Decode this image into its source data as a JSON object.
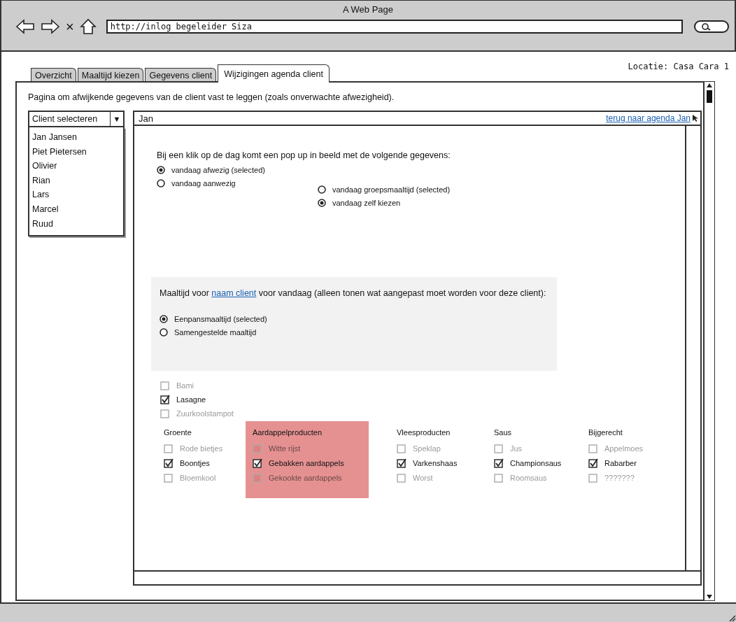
{
  "browser": {
    "title": "A Web Page",
    "url": "http://inlog begeleider Siza",
    "close_glyph": "×"
  },
  "tabs": [
    {
      "label": "Overzicht",
      "selected": false
    },
    {
      "label": "Maaltijd kiezen",
      "selected": false
    },
    {
      "label": "Gegevens client",
      "selected": false
    },
    {
      "label": "Wijzigingen agenda client",
      "selected": true
    }
  ],
  "location": "Locatie: Casa Cara 1",
  "description": "Pagina om afwijkende gegevens van de client vast te leggen (zoals onverwachte afwezigheid).",
  "client_select": {
    "label": "Client selecteren",
    "arrow": "▼",
    "clients": [
      "Jan Jansen",
      "Piet Pietersen",
      "Olivier",
      "Rian",
      "Lars",
      "Marcel",
      "Ruud"
    ]
  },
  "panel": {
    "header": "Jan",
    "link": "terug naar agenda Jan",
    "instruction": "Bij een klik op de dag komt een pop up in beeld met de volgende gegevens:",
    "presence_options": [
      {
        "label": "vandaag afwezig (selected)",
        "selected": true
      },
      {
        "label": "vandaag aanwezig",
        "selected": false
      }
    ],
    "meal_choice_options": [
      {
        "label": "vandaag groepsmaaltijd (selected)",
        "selected": false
      },
      {
        "label": "vandaag zelf kiezen",
        "selected": true
      }
    ],
    "meal_box": {
      "title_start": "Maaltijd voor",
      "title_link": "naam client",
      "title_end": "voor vandaag (alleen tonen wat aangepast moet worden voor deze client):",
      "options": [
        {
          "label": "Eenpansmaaltijd (selected)",
          "selected": true
        },
        {
          "label": "Samengestelde maaltijd",
          "selected": false
        }
      ]
    },
    "dishes": [
      {
        "label": "Bami",
        "checked": false
      },
      {
        "label": "Lasagne",
        "checked": true
      },
      {
        "label": "Zuurkoolstampot",
        "checked": false
      }
    ],
    "categories": [
      {
        "title": "Groente",
        "highlighted": false,
        "items": [
          {
            "label": "Rode bietjes",
            "checked": false
          },
          {
            "label": "Boontjes",
            "checked": true
          },
          {
            "label": "Bloemkool",
            "checked": false
          }
        ]
      },
      {
        "title": "Aardappelproducten",
        "highlighted": true,
        "items": [
          {
            "label": "Witte rijst",
            "checked": false
          },
          {
            "label": "Gebakken aardappels",
            "checked": true
          },
          {
            "label": "Gekookte aardappels",
            "checked": false
          }
        ]
      },
      {
        "title": "Vleesproducten",
        "highlighted": false,
        "items": [
          {
            "label": "Speklap",
            "checked": false
          },
          {
            "label": "Varkenshaas",
            "checked": true
          },
          {
            "label": "Worst",
            "checked": false
          }
        ]
      },
      {
        "title": "Saus",
        "highlighted": false,
        "items": [
          {
            "label": "Jus",
            "checked": false
          },
          {
            "label": "Championsaus",
            "checked": true
          },
          {
            "label": "Roomsaus",
            "checked": false
          }
        ]
      },
      {
        "title": "Bijgerecht",
        "highlighted": false,
        "items": [
          {
            "label": "Appelmoes",
            "checked": false
          },
          {
            "label": "Rabarber",
            "checked": true
          },
          {
            "label": "???????",
            "checked": false
          }
        ]
      }
    ]
  }
}
